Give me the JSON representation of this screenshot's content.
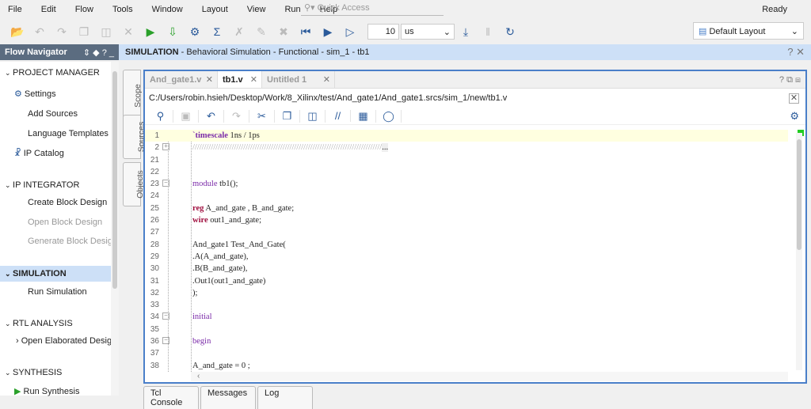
{
  "menu": [
    "File",
    "Edit",
    "Flow",
    "Tools",
    "Window",
    "Layout",
    "View",
    "Run",
    "Help"
  ],
  "quick_access_placeholder": "Quick Access",
  "status": "Ready",
  "toolbar": {
    "run_time_value": "10",
    "run_time_unit": "us",
    "layout": "Default Layout"
  },
  "flow_navigator": {
    "title": "Flow Navigator",
    "sections": [
      {
        "label": "PROJECT MANAGER",
        "items": [
          {
            "label": "Settings",
            "icon": "gear-icon"
          },
          {
            "label": "Add Sources"
          },
          {
            "label": "Language Templates"
          },
          {
            "label": "IP Catalog",
            "icon": "ip-icon"
          }
        ]
      },
      {
        "label": "IP INTEGRATOR",
        "items": [
          {
            "label": "Create Block Design"
          },
          {
            "label": "Open Block Design",
            "disabled": true
          },
          {
            "label": "Generate Block Design",
            "disabled": true
          }
        ]
      },
      {
        "label": "SIMULATION",
        "selected": true,
        "items": [
          {
            "label": "Run Simulation"
          }
        ]
      },
      {
        "label": "RTL ANALYSIS",
        "items": [
          {
            "label": "Open Elaborated Design"
          }
        ]
      },
      {
        "label": "SYNTHESIS",
        "items": [
          {
            "label": "Run Synthesis",
            "icon": "play-icon"
          }
        ]
      }
    ]
  },
  "sim_header": {
    "bold": "SIMULATION",
    "rest": " - Behavioral Simulation - Functional - sim_1 - tb1"
  },
  "side_tabs": [
    "Scope",
    "Sources",
    "Objects"
  ],
  "editor": {
    "tabs": [
      {
        "label": "And_gate1.v"
      },
      {
        "label": "tb1.v",
        "active": true
      },
      {
        "label": "Untitled 1"
      }
    ],
    "path": "C:/Users/robin.hsieh/Desktop/Work/8_Xilinx/test/And_gate1/And_gate1.srcs/sim_1/new/tb1.v",
    "lines": [
      {
        "n": "1",
        "hl": true,
        "parts": [
          [
            "`timescale",
            "dir"
          ],
          [
            " 1ns / 1ps",
            ""
          ]
        ]
      },
      {
        "n": "2",
        "fold": "+",
        "parts": [
          [
            "//////////////////////////////////////////////////////////////////////////////////",
            "cm"
          ],
          [
            "...",
            ""
          ]
        ]
      },
      {
        "n": "21",
        "parts": []
      },
      {
        "n": "22",
        "parts": []
      },
      {
        "n": "23",
        "fold": "-",
        "parts": [
          [
            "module",
            "kw"
          ],
          [
            " tb1();",
            ""
          ]
        ]
      },
      {
        "n": "24",
        "parts": []
      },
      {
        "n": "25",
        "parts": [
          [
            "reg",
            "kw2"
          ],
          [
            " A_and_gate , B_and_gate;",
            ""
          ]
        ]
      },
      {
        "n": "26",
        "parts": [
          [
            "wire",
            "kw2"
          ],
          [
            " out1_and_gate;",
            ""
          ]
        ]
      },
      {
        "n": "27",
        "parts": []
      },
      {
        "n": "28",
        "parts": [
          [
            "And_gate1 Test_And_Gate(",
            ""
          ]
        ]
      },
      {
        "n": "29",
        "parts": [
          [
            ".A(A_and_gate),",
            ""
          ]
        ]
      },
      {
        "n": "30",
        "parts": [
          [
            ".B(B_and_gate),",
            ""
          ]
        ]
      },
      {
        "n": "31",
        "parts": [
          [
            ".Out1(out1_and_gate)",
            ""
          ]
        ]
      },
      {
        "n": "32",
        "parts": [
          [
            ");",
            ""
          ]
        ]
      },
      {
        "n": "33",
        "parts": []
      },
      {
        "n": "34",
        "fold": "-",
        "parts": [
          [
            "initial",
            "kw"
          ]
        ]
      },
      {
        "n": "35",
        "parts": []
      },
      {
        "n": "36",
        "fold": "-",
        "parts": [
          [
            "begin",
            "kw"
          ]
        ]
      },
      {
        "n": "37",
        "parts": []
      },
      {
        "n": "38",
        "parts": [
          [
            "A_and_gate = 0 ;",
            ""
          ]
        ]
      }
    ]
  },
  "bottom_tabs": [
    "Tcl Console",
    "Messages",
    "Log"
  ]
}
